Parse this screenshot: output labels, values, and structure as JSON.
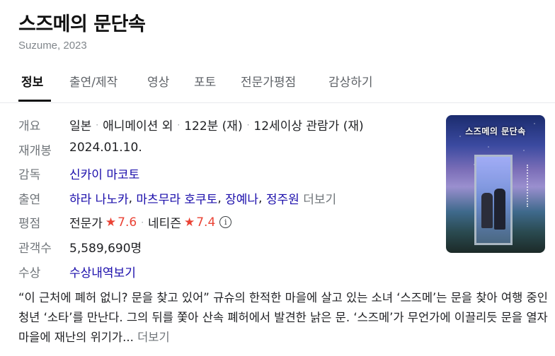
{
  "title": "스즈메의 문단속",
  "subtitle": "Suzume, 2023",
  "tabs": [
    "정보",
    "출연/제작",
    "영상",
    "포토",
    "전문가평점",
    "감상하기"
  ],
  "overview": {
    "label": "개요",
    "items": [
      "일본",
      "애니메이션 외",
      "122분 (재)",
      "12세이상 관람가 (재)"
    ]
  },
  "rerelease": {
    "label": "재개봉",
    "value": "2024.01.10."
  },
  "director": {
    "label": "감독",
    "value": "신카이 마코토"
  },
  "cast": {
    "label": "출연",
    "names": [
      "하라 나노카",
      "마츠무라 호쿠토",
      "장예나",
      "정주원"
    ],
    "more": "더보기"
  },
  "rating": {
    "label": "평점",
    "expert_label": "전문가",
    "expert_score": "7.6",
    "netizen_label": "네티즌",
    "netizen_score": "7.4",
    "star_glyph": "★",
    "info_glyph": "i"
  },
  "audience": {
    "label": "관객수",
    "value": "5,589,690명"
  },
  "awards": {
    "label": "수상",
    "value": "수상내역보기"
  },
  "poster": {
    "title": "스즈메의 문단속"
  },
  "synopsis": {
    "text": "“이 근처에 폐허 없니? 문을 찾고 있어” 규슈의 한적한 마을에 살고 있는 소녀 ‘스즈메’는 문을 찾아 여행 중인 청년 ‘소타’를 만난다. 그의 뒤를 쫓아 산속 폐허에서 발견한 낡은 문. ‘스즈메’가 무언가에 이끌리듯 문을 열자 마을에 재난의 위기가...",
    "more": "더보기"
  },
  "colors": {
    "link": "#1a0dab",
    "score": "#ea4335",
    "muted": "#70757a"
  }
}
